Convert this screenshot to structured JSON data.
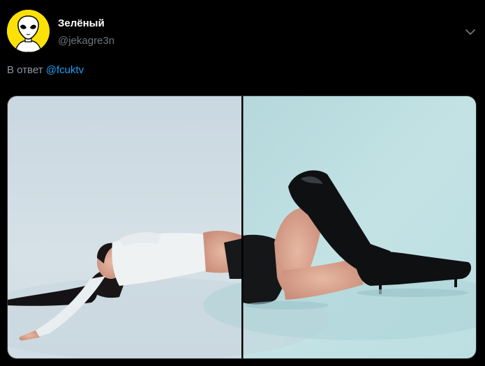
{
  "tweet": {
    "display_name": "Зелёный",
    "handle": "@jekagre3n",
    "reply_prefix": "В ответ",
    "reply_mention": "@fcuktv"
  },
  "icons": {
    "avatar": "alien-avatar-icon",
    "menu": "chevron-down-icon"
  },
  "colors": {
    "background": "#000000",
    "name": "#ffffff",
    "secondary_text": "#6e767d",
    "link": "#1da1f2",
    "avatar_bg": "#fbe106"
  },
  "media": {
    "panels": 2
  }
}
